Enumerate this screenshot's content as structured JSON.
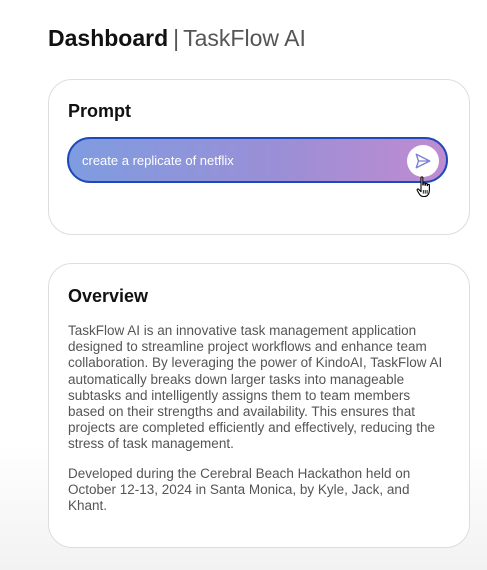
{
  "header": {
    "title": "Dashboard",
    "separator": "|",
    "app_name": "TaskFlow AI"
  },
  "prompt_card": {
    "title": "Prompt",
    "input_value": "create a replicate of netflix",
    "send_icon": "send-icon",
    "cursor_icon": "hand-pointer-icon"
  },
  "overview_card": {
    "title": "Overview",
    "paragraph_1": "TaskFlow AI is an innovative task management application designed to streamline project workflows and enhance team collaboration. By leveraging the power of KindoAI, TaskFlow AI automatically breaks down larger tasks into manageable subtasks and intelligently assigns them to team members based on their strengths and availability. This ensures that projects are completed efficiently and effectively, reducing the stress of task management.",
    "paragraph_2": "Developed during the Cerebral Beach Hackathon held on October 12-13, 2024 in Santa Monica, by Kyle, Jack, and Khant."
  },
  "colors": {
    "prompt_border": "#1f49b8",
    "prompt_gradient_start": "#7f9ce0",
    "prompt_gradient_end": "#c08bd0",
    "send_icon": "#7b7fd6",
    "body_text": "#555555"
  }
}
